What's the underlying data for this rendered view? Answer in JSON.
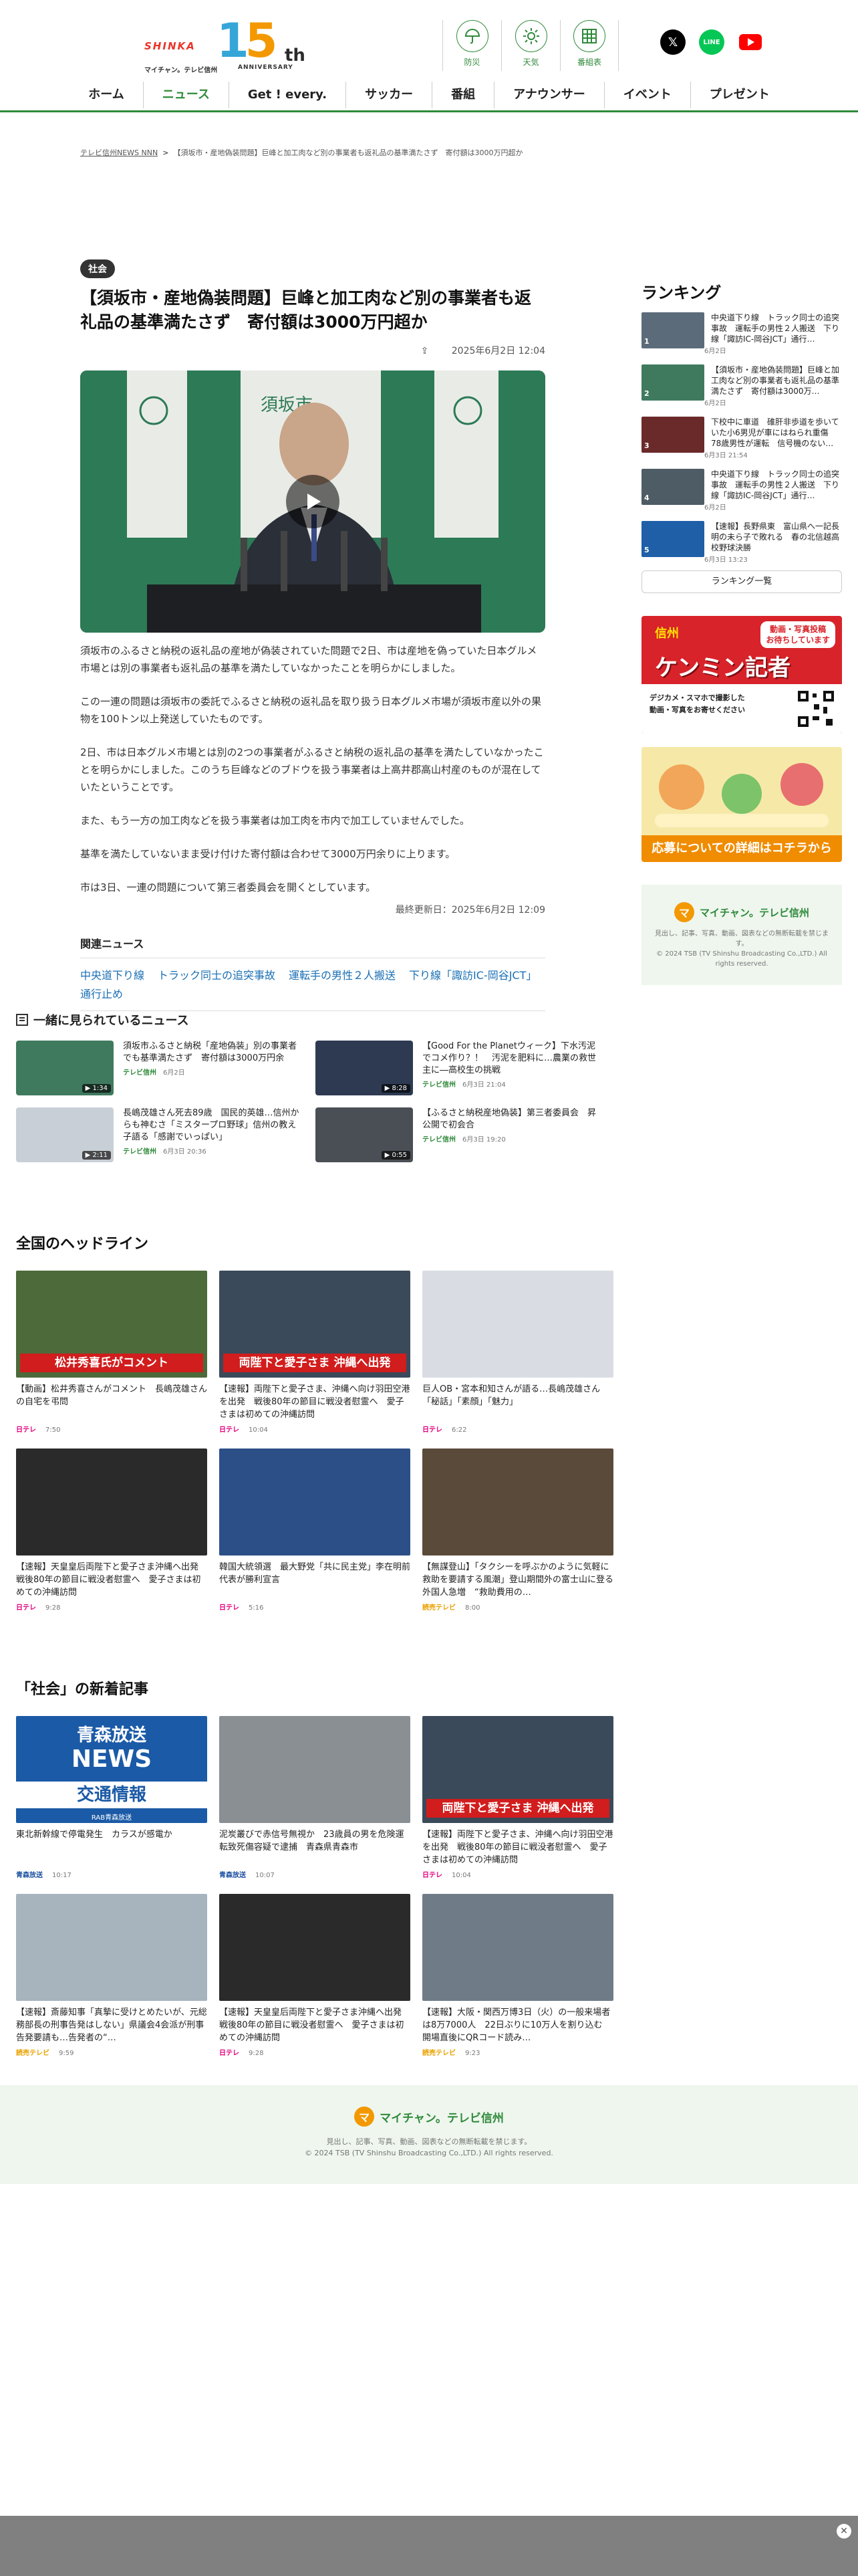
{
  "header": {
    "logo": {
      "shinka": "SHINKA",
      "big": "15",
      "th": "th",
      "sub": "マイチャン。テレビ信州",
      "anniversary": "ANNIVERSARY"
    },
    "icons": [
      {
        "name": "防災",
        "icon": "umbrella-icon"
      },
      {
        "name": "天気",
        "icon": "sun-icon"
      },
      {
        "name": "番組表",
        "icon": "grid-icon"
      }
    ],
    "sns": [
      {
        "name": "X",
        "color": "#000000"
      },
      {
        "name": "LINE",
        "color": "#06c755"
      },
      {
        "name": "YouTube",
        "color": "#ff0000"
      }
    ],
    "nav": [
      "ホーム",
      "ニュース",
      "Get ! every.",
      "サッカー",
      "番組",
      "アナウンサー",
      "イベント",
      "プレゼント"
    ],
    "nav_active": "ニュース",
    "accent": "#2f8a3a"
  },
  "breadcrumb": {
    "home": "テレビ信州NEWS NNN",
    "sep": ">",
    "current": "【須坂市・産地偽装問題】巨峰と加工肉など別の事業者も返礼品の基準満たさず　寄付額は3000万円超か"
  },
  "article": {
    "category": "社会",
    "title": "【須坂市・産地偽装問題】巨峰と加工肉など別の事業者も返礼品の基準満たさず　寄付額は3000万円超か",
    "share": "⇪",
    "date": "2025年6月2日 12:04",
    "paragraphs": [
      "須坂市のふるさと納税の返礼品の産地が偽装されていた問題で2日、市は産地を偽っていた日本グルメ市場とは別の事業者も返礼品の基準を満たしていなかったことを明らかにしました。",
      "この一連の問題は須坂市の委託でふるさと納税の返礼品を取り扱う日本グルメ市場が須坂市産以外の果物を100トン以上発送していたものです。",
      "2日、市は日本グルメ市場とは別の2つの事業者がふるさと納税の返礼品の基準を満たしていなかったことを明らかにしました。このうち巨峰などのブドウを扱う事業者は上高井郡高山村産のものが混在していたということです。",
      "また、もう一方の加工肉などを扱う事業者は加工肉を市内で加工していませんでした。",
      "基準を満たしていないまま受け付けた寄付額は合わせて3000万円余りに上ります。",
      "市は3日、一連の問題について第三者委員会を開くとしています。"
    ],
    "updated": "最終更新日：2025年6月2日 12:09",
    "related_head": "関連ニュース",
    "related": [
      "中央道下り線",
      "トラック同士の追突事故",
      "運転手の男性２人搬送",
      "下り線「諏訪IC-岡谷JCT」通行止め"
    ]
  },
  "sidebar": {
    "ranking_head": "ランキング",
    "ranking": [
      {
        "num": "1",
        "text": "中央道下り線　トラック同士の追突事故　運転手の男性２人搬送　下り線「諏訪IC-岡谷JCT」通行…",
        "date": "6月2日",
        "color": "#5b6b7a"
      },
      {
        "num": "2",
        "text": "【須坂市・産地偽装問題】巨峰と加工肉など別の事業者も返礼品の基準満たさず　寄付額は3000万…",
        "date": "6月2日",
        "color": "#3f7a5f"
      },
      {
        "num": "3",
        "text": "下校中に車道　碓肝非歩道を歩いていた小6男児が車にはねられ重傷　78歳男性が運転　信号機のない…",
        "date": "6月3日 21:54",
        "color": "#6b2a2a"
      },
      {
        "num": "4",
        "text": "中央道下り線　トラック同士の追突事故　運転手の男性２人搬送　下り線「諏訪IC-岡谷JCT」通行…",
        "date": "6月2日",
        "color": "#4e5c66"
      },
      {
        "num": "5",
        "text": "【速報】長野県東　富山県へ一記長明の未ら子で敗れる　春の北信越高校野球決勝",
        "date": "6月3日 13:23",
        "color": "#1e5fa8"
      }
    ],
    "ranking_all": "ランキング一覧",
    "banner1": {
      "top": "動画・写真投稿",
      "top2": "お待ちしています",
      "name": "信州",
      "big": "ケンミン記者",
      "desc": "デジカメ・スマホで撮影した",
      "desc2": "動画・写真をお寄せください",
      "bg": "#d8232a"
    },
    "banner2": {
      "cta": "応募についての詳細はコチラから"
    },
    "footer": {
      "name": "マイチャン。テレビ信州",
      "desc": "見出し、記事、写真、動画、図表などの無断転載を禁じます。",
      "copy": "© 2024 TSB (TV Shinshu Broadcasting Co.,LTD.) All rights reserved."
    }
  },
  "watched": {
    "head": "一緒に見られているニュース",
    "items": [
      {
        "text": "須坂市ふるさと納税「産地偽装」別の事業者でも基準満たさず　寄付額は3000万円余",
        "src": "テレビ信州",
        "date": "6月2日",
        "time": "1:34"
      },
      {
        "text": "【Good For the Planetウィーク】下水汚泥でコメ作り？！　汚泥を肥料に…農業の救世主に―高校生の挑戦",
        "src": "テレビ信州",
        "date": "6月3日 21:04",
        "time": "8:28"
      },
      {
        "text": "長嶋茂雄さん死去89歳　国民的英雄…信州からも神むさ「ミスタープロ野球」信州の教え子語る「感謝でいっぱい」",
        "src": "テレビ信州",
        "date": "6月3日 20:36",
        "time": "2:11"
      },
      {
        "text": "【ふるさと納税産地偽装】第三者委員会　昇公開で初会合",
        "src": "テレビ信州",
        "date": "6月3日 19:20",
        "time": "0:55"
      }
    ]
  },
  "headlines": {
    "head": "全国のヘッドライン",
    "cards": [
      {
        "text": "【動画】松井秀喜さんがコメント　長嶋茂雄さんの自宅を弔問",
        "src": "日テレ",
        "src_class": "ntv",
        "time": "7:50",
        "banner": "松井秀喜氏がコメント",
        "color": "#4d6a3a"
      },
      {
        "text": "【速報】両陛下と愛子さま、沖縄へ向け羽田空港を出発　戦後80年の節目に戦没者慰霊へ　愛子さまは初めての沖縄訪問",
        "src": "日テレ",
        "src_class": "ntv",
        "time": "10:04",
        "banner": "両陛下と愛子さま 沖縄へ出発",
        "color": "#3a4a5a"
      },
      {
        "text": "巨人OB・宮本和知さんが語る…長嶋茂雄さん「秘話」「素顔」「魅力」",
        "src": "日テレ",
        "src_class": "ntv",
        "time": "6:22",
        "banner": "",
        "color": "#d9dde3"
      },
      {
        "text": "【速報】天皇皇后両陛下と愛子さま沖縄へ出発　戦後80年の節目に戦没者慰霊へ　愛子さまは初めての沖縄訪問",
        "src": "日テレ",
        "src_class": "ntv",
        "time": "9:28",
        "banner": "",
        "color": "#2a2a2a"
      },
      {
        "text": "韓国大統領選　最大野党「共に民主党」李在明前代表が勝利宣言",
        "src": "日テレ",
        "src_class": "ntv",
        "time": "5:16",
        "banner": "",
        "color": "#2c4f88"
      },
      {
        "text": "【無謀登山】「タクシーを呼ぶかのように気軽に救助を要請する風潮」登山期間外の富士山に登る外国人急増　“救助費用の…",
        "src": "読売テレビ",
        "src_class": "ytv",
        "time": "8:00",
        "banner": "",
        "color": "#5a4a3a"
      }
    ]
  },
  "social": {
    "head": "「社会」の新着記事",
    "cards": [
      {
        "text": "東北新幹線で停電発生　カラスが感電か",
        "src": "青森放送",
        "src_class": "abs",
        "time": "10:17",
        "banner": "",
        "color": "#1b5aa6"
      },
      {
        "text": "泥炭叢びで赤信号無視か　23歳員の男を危険運転致死傷容疑で逮捕　青森県青森市",
        "src": "青森放送",
        "src_class": "abs",
        "time": "10:07",
        "banner": "",
        "color": "#8a8f94"
      },
      {
        "text": "【速報】両陛下と愛子さま、沖縄へ向け羽田空港を出発　戦後80年の節目に戦没者慰霊へ　愛子さまは初めての沖縄訪問",
        "src": "日テレ",
        "src_class": "ntv",
        "time": "10:04",
        "banner": "両陛下と愛子さま 沖縄へ出発",
        "color": "#3a4a5a"
      },
      {
        "text": "【速報】斎藤知事「真摯に受けとめたいが、元総務部長の刑事告発はしない」県議会4会派が刑事告発要請も…告発者の“…",
        "src": "読売テレビ",
        "src_class": "ytv",
        "time": "9:59",
        "banner": "",
        "color": "#a7b3bd"
      },
      {
        "text": "【速報】天皇皇后両陛下と愛子さま沖縄へ出発　戦後80年の節目に戦没者慰霊へ　愛子さまは初めての沖縄訪問",
        "src": "日テレ",
        "src_class": "ntv",
        "time": "9:28",
        "banner": "",
        "color": "#2a2a2a"
      },
      {
        "text": "【速報】大阪・関西万博3日（火）の一般来場者は8万7000人　22日ぶりに10万人を割り込む　開場直後にQRコード読み…",
        "src": "読売テレビ",
        "src_class": "ytv",
        "time": "9:23",
        "banner": "",
        "color": "#6f7c88"
      }
    ],
    "news_card": {
      "line1": "青森放送",
      "line2": "NEWS",
      "line3": "交通情報",
      "tag": "RAB青森放送"
    }
  },
  "footer": {
    "name": "マイチャン。テレビ信州",
    "desc": "見出し、記事、写真、動画、図表などの無断転載を禁じます。",
    "copy": "© 2024 TSB (TV Shinshu Broadcasting Co.,LTD.) All rights reserved."
  }
}
